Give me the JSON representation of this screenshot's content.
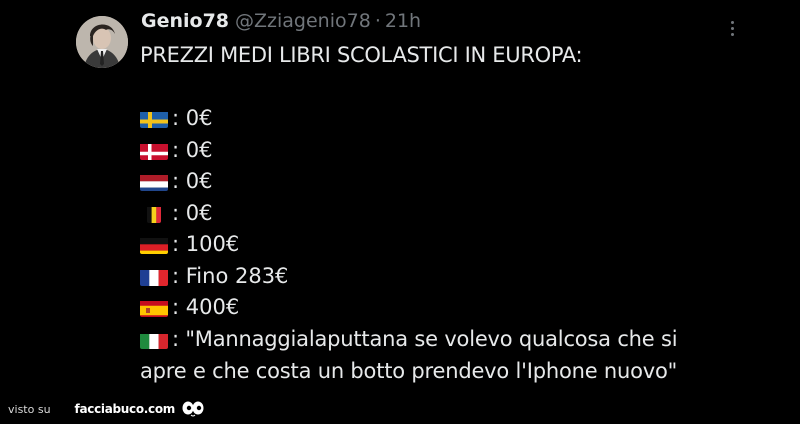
{
  "tweet": {
    "display_name": "Genio78",
    "handle": "@Zziagenio78",
    "separator": "·",
    "time": "21h",
    "headline": "PREZZI MEDI LIBRI SCOLASTICI IN EUROPA:",
    "rows": [
      {
        "flag": "sweden-flag",
        "text": ": 0€"
      },
      {
        "flag": "denmark-flag",
        "text": ": 0€"
      },
      {
        "flag": "netherlands-flag",
        "text": ": 0€"
      },
      {
        "flag": "belgium-flag",
        "text": ": 0€"
      },
      {
        "flag": "germany-flag",
        "text": ": 100€"
      },
      {
        "flag": "france-flag",
        "text": ": Fino 283€"
      },
      {
        "flag": "spain-flag",
        "text": ": 400€"
      }
    ],
    "italy_flag": "italy-flag",
    "quote_line1": ": \"Mannaggialaputtana se volevo qualcosa che si",
    "quote_line2": "apre e che costa un botto prendevo l'Iphone nuovo\""
  },
  "footer": {
    "visto": "visto su",
    "brand": "facciabuco.com"
  },
  "colors": {
    "background": "#000000",
    "text": "#e7e9ea",
    "muted": "#71767b"
  }
}
